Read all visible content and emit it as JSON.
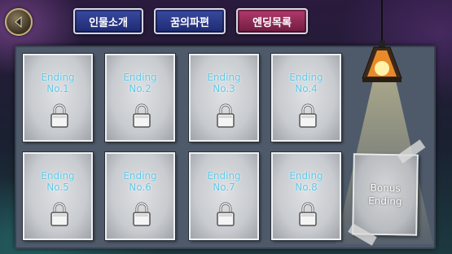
{
  "tabs": [
    {
      "label": "인물소개",
      "active": false
    },
    {
      "label": "꿈의파편",
      "active": false
    },
    {
      "label": "엔딩목록",
      "active": true
    }
  ],
  "endings": [
    {
      "line1": "Ending",
      "line2": "No.1",
      "locked": true
    },
    {
      "line1": "Ending",
      "line2": "No.2",
      "locked": true
    },
    {
      "line1": "Ending",
      "line2": "No.3",
      "locked": true
    },
    {
      "line1": "Ending",
      "line2": "No.4",
      "locked": true
    },
    {
      "line1": "Ending",
      "line2": "No.5",
      "locked": true
    },
    {
      "line1": "Ending",
      "line2": "No.6",
      "locked": true
    },
    {
      "line1": "Ending",
      "line2": "No.7",
      "locked": true
    },
    {
      "line1": "Ending",
      "line2": "No.8",
      "locked": true
    }
  ],
  "bonus": {
    "line1": "Bonus",
    "line2": "Ending"
  },
  "icons": {
    "back": "back-arrow-icon",
    "lock": "padlock-icon",
    "lamp": "hanging-lamp-icon"
  },
  "colors": {
    "label_cyan": "#5fc8e8",
    "tab_blue": "#2a3a8c",
    "tab_active": "#9c2c5c"
  }
}
